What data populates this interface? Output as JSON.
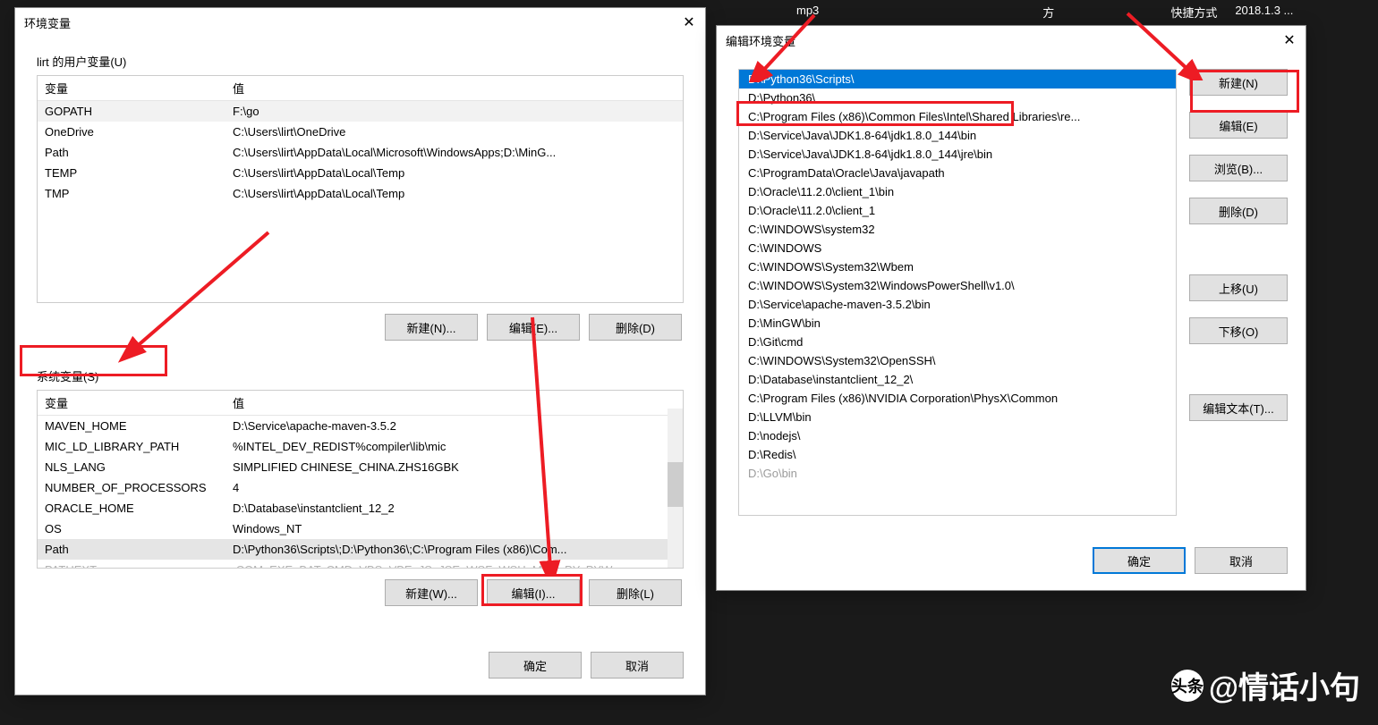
{
  "desktop": {
    "icons": [
      "mp3",
      "方",
      "快捷方式",
      "2018.1.3 ..."
    ]
  },
  "dialog1": {
    "title": "环境变量",
    "user_section_label": "lirt 的用户变量(U)",
    "system_section_label": "系统变量(S)",
    "headers": {
      "var": "变量",
      "val": "值"
    },
    "user_vars": [
      {
        "name": "GOPATH",
        "value": "F:\\go"
      },
      {
        "name": "OneDrive",
        "value": "C:\\Users\\lirt\\OneDrive"
      },
      {
        "name": "Path",
        "value": "C:\\Users\\lirt\\AppData\\Local\\Microsoft\\WindowsApps;D:\\MinG..."
      },
      {
        "name": "TEMP",
        "value": "C:\\Users\\lirt\\AppData\\Local\\Temp"
      },
      {
        "name": "TMP",
        "value": "C:\\Users\\lirt\\AppData\\Local\\Temp"
      }
    ],
    "system_vars": [
      {
        "name": "MAVEN_HOME",
        "value": "D:\\Service\\apache-maven-3.5.2"
      },
      {
        "name": "MIC_LD_LIBRARY_PATH",
        "value": "%INTEL_DEV_REDIST%compiler\\lib\\mic"
      },
      {
        "name": "NLS_LANG",
        "value": "SIMPLIFIED CHINESE_CHINA.ZHS16GBK"
      },
      {
        "name": "NUMBER_OF_PROCESSORS",
        "value": "4"
      },
      {
        "name": "ORACLE_HOME",
        "value": "D:\\Database\\instantclient_12_2"
      },
      {
        "name": "OS",
        "value": "Windows_NT"
      },
      {
        "name": "Path",
        "value": "D:\\Python36\\Scripts\\;D:\\Python36\\;C:\\Program Files (x86)\\Com..."
      },
      {
        "name": "PATHEXT",
        "value": ".COM;.EXE;.BAT;.CMD;.VBS;.VBE;.JS;.JSE;.WSF;.WSH;.MSC;.PY;.PYW"
      }
    ],
    "btn_new_user": "新建(N)...",
    "btn_edit_user": "编辑(E)...",
    "btn_delete_user": "删除(D)",
    "btn_new_sys": "新建(W)...",
    "btn_edit_sys": "编辑(I)...",
    "btn_delete_sys": "删除(L)",
    "btn_ok": "确定",
    "btn_cancel": "取消"
  },
  "dialog2": {
    "title": "编辑环境变量",
    "items": [
      "D:\\Python36\\Scripts\\",
      "D:\\Python36\\",
      "C:\\Program Files (x86)\\Common Files\\Intel\\Shared Libraries\\re...",
      "D:\\Service\\Java\\JDK1.8-64\\jdk1.8.0_144\\bin",
      "D:\\Service\\Java\\JDK1.8-64\\jdk1.8.0_144\\jre\\bin",
      "C:\\ProgramData\\Oracle\\Java\\javapath",
      "D:\\Oracle\\11.2.0\\client_1\\bin",
      "D:\\Oracle\\11.2.0\\client_1",
      "C:\\WINDOWS\\system32",
      "C:\\WINDOWS",
      "C:\\WINDOWS\\System32\\Wbem",
      "C:\\WINDOWS\\System32\\WindowsPowerShell\\v1.0\\",
      "D:\\Service\\apache-maven-3.5.2\\bin",
      "D:\\MinGW\\bin",
      "D:\\Git\\cmd",
      "C:\\WINDOWS\\System32\\OpenSSH\\",
      "D:\\Database\\instantclient_12_2\\",
      "C:\\Program Files (x86)\\NVIDIA Corporation\\PhysX\\Common",
      "D:\\LLVM\\bin",
      "D:\\nodejs\\",
      "D:\\Redis\\",
      "D:\\Go\\bin"
    ],
    "btn_new": "新建(N)",
    "btn_edit": "编辑(E)",
    "btn_browse": "浏览(B)...",
    "btn_delete": "删除(D)",
    "btn_up": "上移(U)",
    "btn_down": "下移(O)",
    "btn_edit_text": "编辑文本(T)...",
    "btn_ok": "确定",
    "btn_cancel": "取消"
  },
  "watermark": {
    "logo": "头条",
    "text": "@情话小句"
  }
}
